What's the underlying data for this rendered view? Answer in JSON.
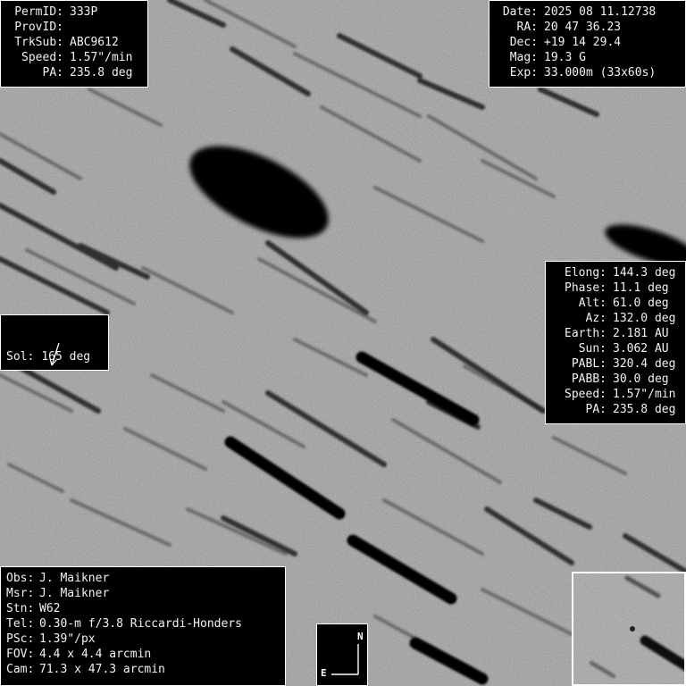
{
  "header_left": [
    {
      "label": "PermID:",
      "value": "333P"
    },
    {
      "label": "ProvID:",
      "value": ""
    },
    {
      "label": "TrkSub:",
      "value": "ABC9612"
    },
    {
      "label": "Speed:",
      "value": "1.57\"/min"
    },
    {
      "label": "PA:",
      "value": "235.8 deg"
    }
  ],
  "header_right": [
    {
      "label": "Date:",
      "value": "2025 08 11.12738"
    },
    {
      "label": "RA:",
      "value": "20 47 36.23"
    },
    {
      "label": "Dec:",
      "value": "+19 14 29.4"
    },
    {
      "label": "Mag:",
      "value": "19.3 G"
    },
    {
      "label": "Exp:",
      "value": "33.000m (33x60s)"
    }
  ],
  "geometry": [
    {
      "label": "Elong:",
      "value": "144.3 deg"
    },
    {
      "label": "Phase:",
      "value": "11.1 deg"
    },
    {
      "label": "Alt:",
      "value": "61.0 deg"
    },
    {
      "label": "Az:",
      "value": "132.0 deg"
    },
    {
      "label": "Earth:",
      "value": "2.181 AU"
    },
    {
      "label": "Sun:",
      "value": "3.062 AU"
    },
    {
      "label": "PABL:",
      "value": "320.4 deg"
    },
    {
      "label": "PABB:",
      "value": "30.0 deg"
    },
    {
      "label": "Speed:",
      "value": "1.57\"/min"
    },
    {
      "label": "PA:",
      "value": "235.8 deg"
    }
  ],
  "sol": {
    "label": "Sol:",
    "value": "165 deg"
  },
  "observer": [
    {
      "label": "Obs:",
      "value": "J. Maikner"
    },
    {
      "label": "Msr:",
      "value": "J. Maikner"
    },
    {
      "label": "Stn:",
      "value": "W62"
    },
    {
      "label": "Tel:",
      "value": "0.30-m f/3.8 Riccardi-Honders"
    },
    {
      "label": "PSc:",
      "value": "1.39\"/px"
    },
    {
      "label": "FOV:",
      "value": "4.4 x 4.4 arcmin"
    },
    {
      "label": "Cam:",
      "value": "71.3 x 47.3 arcmin"
    }
  ],
  "compass": {
    "north": "N",
    "east": "E"
  },
  "colors": {
    "sky": "#8e8e8e",
    "trail": "#000000",
    "panel_bg": "#000000",
    "panel_text": "#f2f2f2"
  }
}
